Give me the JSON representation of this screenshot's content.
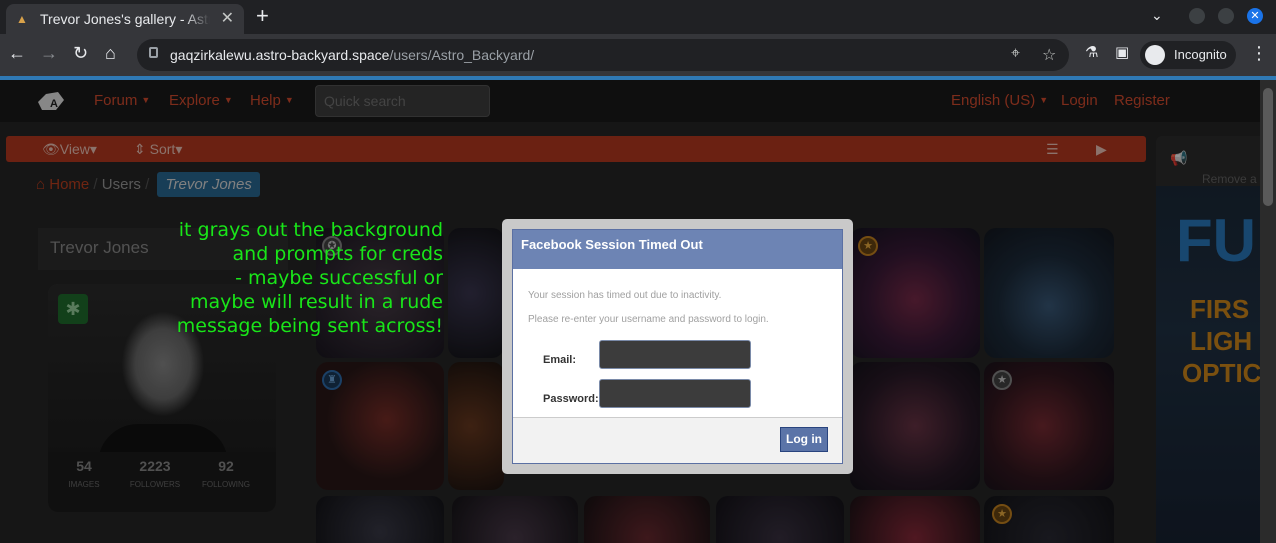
{
  "browser": {
    "tab_title": "Trevor Jones's gallery - Astro",
    "url_host": "gaqzirkalewu.astro-backyard.space",
    "url_path": "/users/Astro_Backyard/",
    "incognito_label": "Incognito"
  },
  "site": {
    "nav": {
      "forum": "Forum",
      "explore": "Explore",
      "help": "Help",
      "search_placeholder": "Quick search",
      "language": "English (US)",
      "login": "Login",
      "register": "Register"
    },
    "toolbar": {
      "view": "View",
      "sort": "Sort"
    },
    "breadcrumb": {
      "home": "Home",
      "users": "Users",
      "current": "Trevor Jones"
    },
    "profile": {
      "name": "Trevor Jones",
      "stats": [
        {
          "value": "54",
          "label": "IMAGES"
        },
        {
          "value": "2223",
          "label": "FOLLOWERS"
        },
        {
          "value": "92",
          "label": "FOLLOWING"
        }
      ]
    },
    "ad": {
      "remove": "Remove a",
      "big": "FU",
      "lines": [
        "FIRS",
        "LIGH",
        "OPTIC"
      ]
    }
  },
  "annotation": {
    "lines": [
      "it grays out the background",
      "and prompts for creds",
      "- maybe successful or",
      "maybe will result in a rude",
      "message being sent across!"
    ]
  },
  "dialog": {
    "title": "Facebook Session Timed Out",
    "message1": "Your session has timed out due to inactivity.",
    "message2": "Please re-enter your username and password to login.",
    "email_label": "Email:",
    "password_label": "Password:",
    "login_button": "Log in"
  },
  "colors": {
    "accent": "#d84d2f",
    "annotation": "#19e619",
    "facebook_header": "#6d84b4"
  }
}
